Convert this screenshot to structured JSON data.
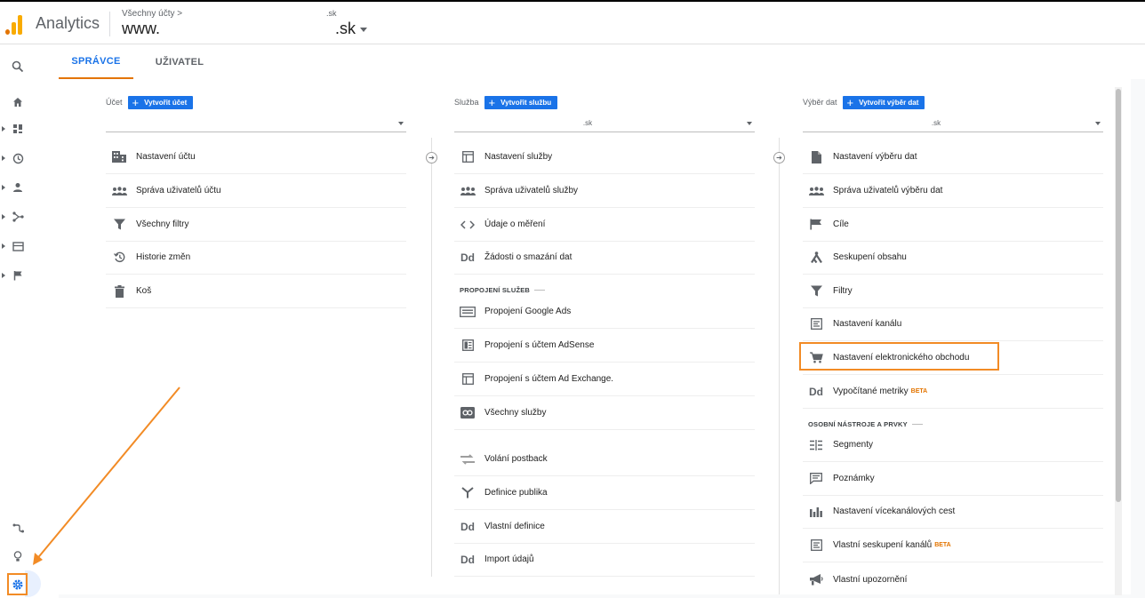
{
  "header": {
    "app_name": "Analytics",
    "breadcrumb": "Všechny účty >",
    "account": "www.",
    "property_small": ".sk",
    "property": ".sk"
  },
  "rail": {
    "icons": [
      "search-icon",
      "home-icon",
      "customization-icon",
      "realtime-icon",
      "audience-icon",
      "acquisition-icon",
      "behavior-icon",
      "conversions-icon",
      "attribution-icon",
      "discover-icon",
      "admin-gear-icon"
    ]
  },
  "tabs": [
    {
      "label": "SPRÁVCE",
      "active": true
    },
    {
      "label": "UŽIVATEL",
      "active": false
    }
  ],
  "account_col": {
    "label": "Účet",
    "create": "Vytvořit účet",
    "select_value": "",
    "items": [
      "Nastavení účtu",
      "Správa uživatelů účtu",
      "Všechny filtry",
      "Historie změn",
      "Koš"
    ]
  },
  "property_col": {
    "label": "Služba",
    "create": "Vytvořit službu",
    "select_value": ".sk",
    "items": [
      "Nastavení služby",
      "Správa uživatelů služby",
      "Údaje o měření",
      "Žádosti o smazání dat"
    ],
    "section": "PROPOJENÍ SLUŽEB",
    "links": [
      "Propojení Google Ads",
      "Propojení s účtem AdSense",
      "Propojení s účtem Ad Exchange.",
      "Všechny služby"
    ],
    "extra": [
      "Volání postback",
      "Definice publika",
      "Vlastní definice",
      "Import údajů"
    ]
  },
  "view_col": {
    "label": "Výběr dat",
    "create": "Vytvořit výběr dat",
    "select_value": ".sk",
    "items": [
      "Nastavení výběru dat",
      "Správa uživatelů výběru dat",
      "Cíle",
      "Seskupení obsahu",
      "Filtry",
      "Nastavení kanálu",
      "Nastavení elektronického obchodu",
      "Vypočítané metriky"
    ],
    "beta": "BETA",
    "section": "OSOBNÍ NÁSTROJE A PRVKY",
    "tools": [
      "Segmenty",
      "Poznámky",
      "Nastavení vícekanálových cest",
      "Vlastní seskupení kanálů",
      "Vlastní upozornění"
    ],
    "tools_beta": "BETA"
  },
  "colors": {
    "accent": "#1a73e8",
    "highlight": "#f28b25",
    "logo_orange": "#e37400",
    "logo_yellow": "#f9ab00"
  }
}
